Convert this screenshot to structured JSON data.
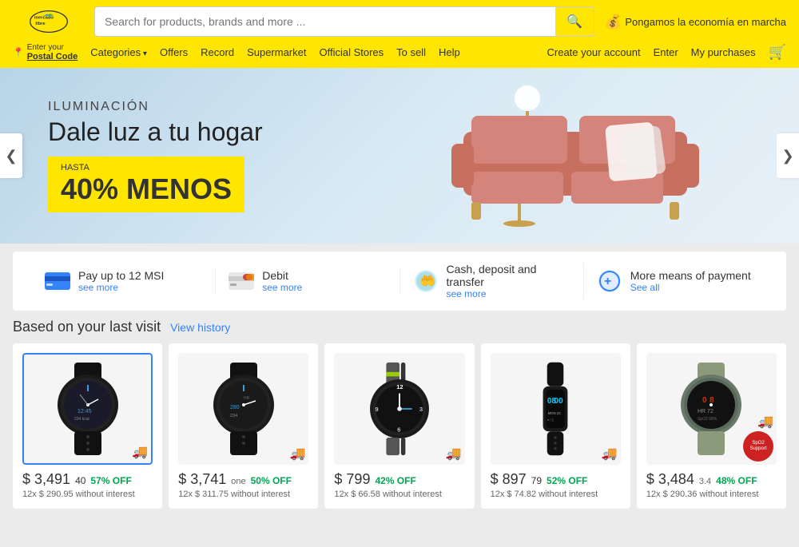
{
  "header": {
    "logo_text": "mercado libre",
    "search_placeholder": "Search for products, brands and more ...",
    "economy_text": "Pongamos la economía en marcha",
    "nav_links": [
      {
        "label": "Categories",
        "has_arrow": true
      },
      {
        "label": "Offers",
        "has_arrow": false
      },
      {
        "label": "Record",
        "has_arrow": false
      },
      {
        "label": "Supermarket",
        "has_arrow": false
      },
      {
        "label": "Official Stores",
        "has_arrow": false
      },
      {
        "label": "To sell",
        "has_arrow": false
      },
      {
        "label": "Help",
        "has_arrow": false
      }
    ],
    "postal_label": "Enter your",
    "postal_sub": "Postal Code",
    "nav_right": [
      {
        "label": "Create your account"
      },
      {
        "label": "Enter"
      },
      {
        "label": "My purchases"
      },
      {
        "label": "cart"
      }
    ]
  },
  "banner": {
    "subtitle": "ILUMINACIÓN",
    "title": "Dale luz a tu hogar",
    "badge_top": "HASTA",
    "badge_main": "40% MENOS",
    "prev_arrow": "❮",
    "next_arrow": "❯"
  },
  "payment_strip": {
    "items": [
      {
        "icon": "💳",
        "title": "Pay up to 12 MSI",
        "link_label": "see more"
      },
      {
        "icon": "💳",
        "title": "Debit",
        "link_label": "see more"
      },
      {
        "icon": "🤲",
        "title": "Cash, deposit and transfer",
        "link_label": "see more"
      },
      {
        "icon": "➕",
        "title": "More means of payment",
        "link_label": "See all"
      }
    ]
  },
  "history_section": {
    "title": "Based on your last visit",
    "link_label": "View history"
  },
  "products": [
    {
      "price_main": "$ 3,491",
      "price_cents": "40",
      "price_off": "57% OFF",
      "installment": "12x $ 290.95 without interest",
      "selected": true,
      "color": "dark"
    },
    {
      "price_main": "$ 3,741",
      "price_extra": "one",
      "price_off": "50% OFF",
      "installment": "12x $ 311.75 without interest",
      "selected": false,
      "color": "dark"
    },
    {
      "price_main": "$ 799",
      "price_off": "42% OFF",
      "installment": "12x $ 66.58 without interest",
      "selected": false,
      "color": "dark"
    },
    {
      "price_main": "$ 897",
      "price_cents": "79",
      "price_off": "52% OFF",
      "installment": "12x $ 74.82 without interest",
      "selected": false,
      "color": "dark"
    },
    {
      "price_main": "$ 3,484",
      "price_extra": "3.4",
      "price_off": "48% OFF",
      "installment": "12x $ 290.36 without interest",
      "selected": false,
      "color": "gray",
      "badge": "SpO2 Support"
    }
  ]
}
